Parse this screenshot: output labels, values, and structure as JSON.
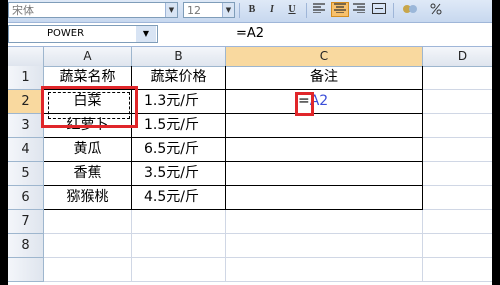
{
  "toolbar": {
    "font_name": "宋体",
    "font_size": "12",
    "bold_label": "B",
    "italic_label": "I",
    "underline_label": "U"
  },
  "formula_bar": {
    "name_box": "POWER",
    "formula": "=A2"
  },
  "columns": [
    "A",
    "B",
    "C",
    "D"
  ],
  "rows": [
    {
      "num": "1",
      "a": "蔬菜名称",
      "b": "蔬菜价格",
      "c": "备注"
    },
    {
      "num": "2",
      "a": "白菜",
      "b": "1.3元/斤",
      "c_prefix": "=",
      "c_ref": "A2"
    },
    {
      "num": "3",
      "a": "红萝卜",
      "b": "1.5元/斤",
      "c": ""
    },
    {
      "num": "4",
      "a": "黄瓜",
      "b": "6.5元/斤",
      "c": ""
    },
    {
      "num": "5",
      "a": "香蕉",
      "b": "3.5元/斤",
      "c": ""
    },
    {
      "num": "6",
      "a": "猕猴桃",
      "b": "4.5元/斤",
      "c": ""
    },
    {
      "num": "7"
    },
    {
      "num": "8"
    }
  ],
  "colors": {
    "highlight": "#e0262a",
    "reference_text": "#3b4ed8",
    "header_selected": "#f9d99f"
  }
}
